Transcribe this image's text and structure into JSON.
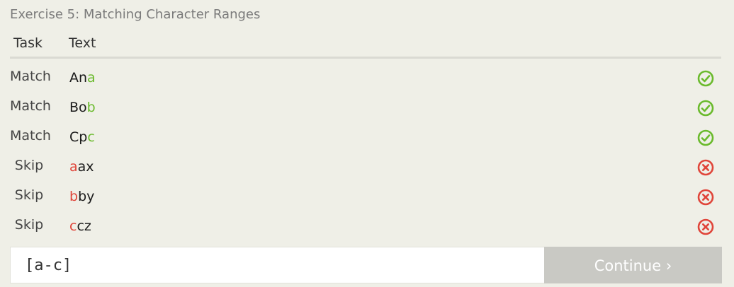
{
  "exercise": {
    "title": "Exercise 5: Matching Character Ranges"
  },
  "table": {
    "headers": {
      "task": "Task",
      "text": "Text"
    },
    "rows": [
      {
        "task": "Match",
        "pre": "An",
        "hl": "a",
        "post": "",
        "status": "success"
      },
      {
        "task": "Match",
        "pre": "Bo",
        "hl": "b",
        "post": "",
        "status": "success"
      },
      {
        "task": "Match",
        "pre": "Cp",
        "hl": "c",
        "post": "",
        "status": "success"
      },
      {
        "task": "Skip",
        "pre": "",
        "hl": "a",
        "post": "ax",
        "status": "fail"
      },
      {
        "task": "Skip",
        "pre": "",
        "hl": "b",
        "post": "by",
        "status": "fail"
      },
      {
        "task": "Skip",
        "pre": "",
        "hl": "c",
        "post": "cz",
        "status": "fail"
      }
    ]
  },
  "answer": {
    "value": "[a-c]",
    "continue_label": "Continue ›"
  },
  "icons": {
    "success": "check-circle-icon",
    "fail": "x-circle-icon"
  },
  "colors": {
    "success": "#6aba2c",
    "fail": "#e0453a",
    "background": "#efefe7",
    "continue_bg": "#c9c9c4"
  }
}
